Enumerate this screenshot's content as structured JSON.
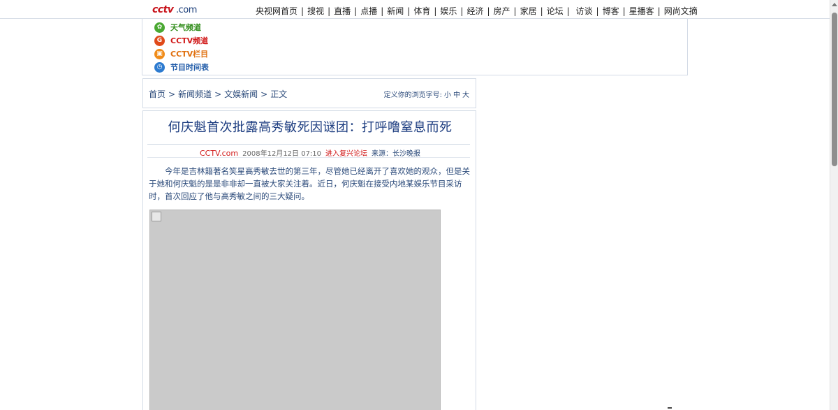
{
  "logo": {
    "text_left": "cctv",
    "text_right": ".com"
  },
  "top_nav": [
    "央视网首页",
    "搜视",
    "直播",
    "点播",
    "新闻",
    "体育",
    "娱乐",
    "经济",
    "房产",
    "家居",
    "论坛",
    "访谈",
    "博客",
    "星播客",
    "网尚文摘"
  ],
  "channels": [
    {
      "label": "天气频道",
      "icon": "weather-icon"
    },
    {
      "label": "CCTV频道",
      "icon": "cctv-channel-icon"
    },
    {
      "label": "CCTV栏目",
      "icon": "cctv-column-icon"
    },
    {
      "label": "节目时间表",
      "icon": "schedule-icon"
    }
  ],
  "breadcrumb": [
    "首页",
    "新闻频道",
    "文娱新闻",
    "正文"
  ],
  "font_size": {
    "label": "定义你的浏览字号:",
    "small": "小",
    "medium": "中",
    "large": "大"
  },
  "article": {
    "title": "何庆魁首次批露高秀敏死因谜团：打呼噜窒息而死",
    "source_site": "CCTV.com",
    "date": "2008年12月12日 07:10",
    "forum_link": "进入复兴论坛",
    "source": "来源：长沙晚报",
    "intro": "今年是吉林籍著名笑星高秀敏去世的第三年，尽管她已经离开了喜欢她的观众，但是关于她和何庆魁的是是非非却一直被大家关注着。近日，何庆魁在接受内地某娱乐节目采访时，首次回应了他与高秀敏之间的三大疑问。"
  }
}
